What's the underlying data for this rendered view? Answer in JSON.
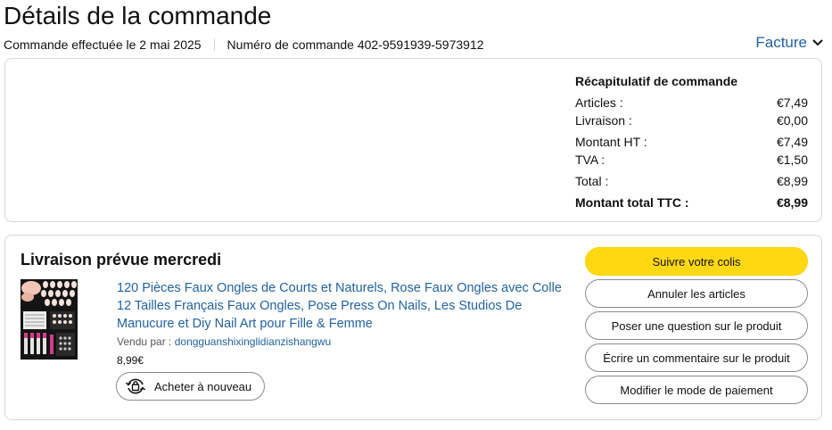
{
  "header": {
    "title": "Détails de la commande",
    "order_date": "Commande effectuée le 2 mai 2025",
    "order_number": "Numéro de commande 402-9591939-5973912",
    "invoice_label": "Facture"
  },
  "summary": {
    "title": "Récapitulatif de commande",
    "rows": [
      {
        "label": "Articles :",
        "value": "€7,49"
      },
      {
        "label": "Livraison :",
        "value": "€0,00"
      },
      {
        "label": "Montant HT :",
        "value": "€7,49"
      },
      {
        "label": "TVA :",
        "value": "€1,50"
      },
      {
        "label": "Total :",
        "value": "€8,99"
      },
      {
        "label": "Montant total TTC :",
        "value": "€8,99"
      }
    ]
  },
  "delivery": {
    "title": "Livraison prévue mercredi",
    "product": {
      "title": "120 Pièces Faux Ongles de Courts et Naturels, Rose Faux Ongles avec Colle 12 Tailles Français Faux Ongles, Pose Press On Nails, Les Studios De Manucure et Diy Nail Art pour Fille & Femme",
      "sold_by_label": "Vendu par  :",
      "seller": "dongguanshixinglidianzishangwu",
      "price": "8,99€",
      "rebuy_label": "Acheter à nouveau"
    },
    "actions": {
      "track": "Suivre votre colis",
      "cancel": "Annuler les articles",
      "question": "Poser une question sur le produit",
      "review": "Écrire un commentaire sur le produit",
      "payment": "Modifier le mode de paiement"
    }
  },
  "colors": {
    "link": "#2162a1",
    "primary_button": "#ffd814",
    "border": "#d5d9d9"
  },
  "icons": [
    "chevron-down-icon",
    "buy-again-icon",
    "product-thumbnail"
  ]
}
